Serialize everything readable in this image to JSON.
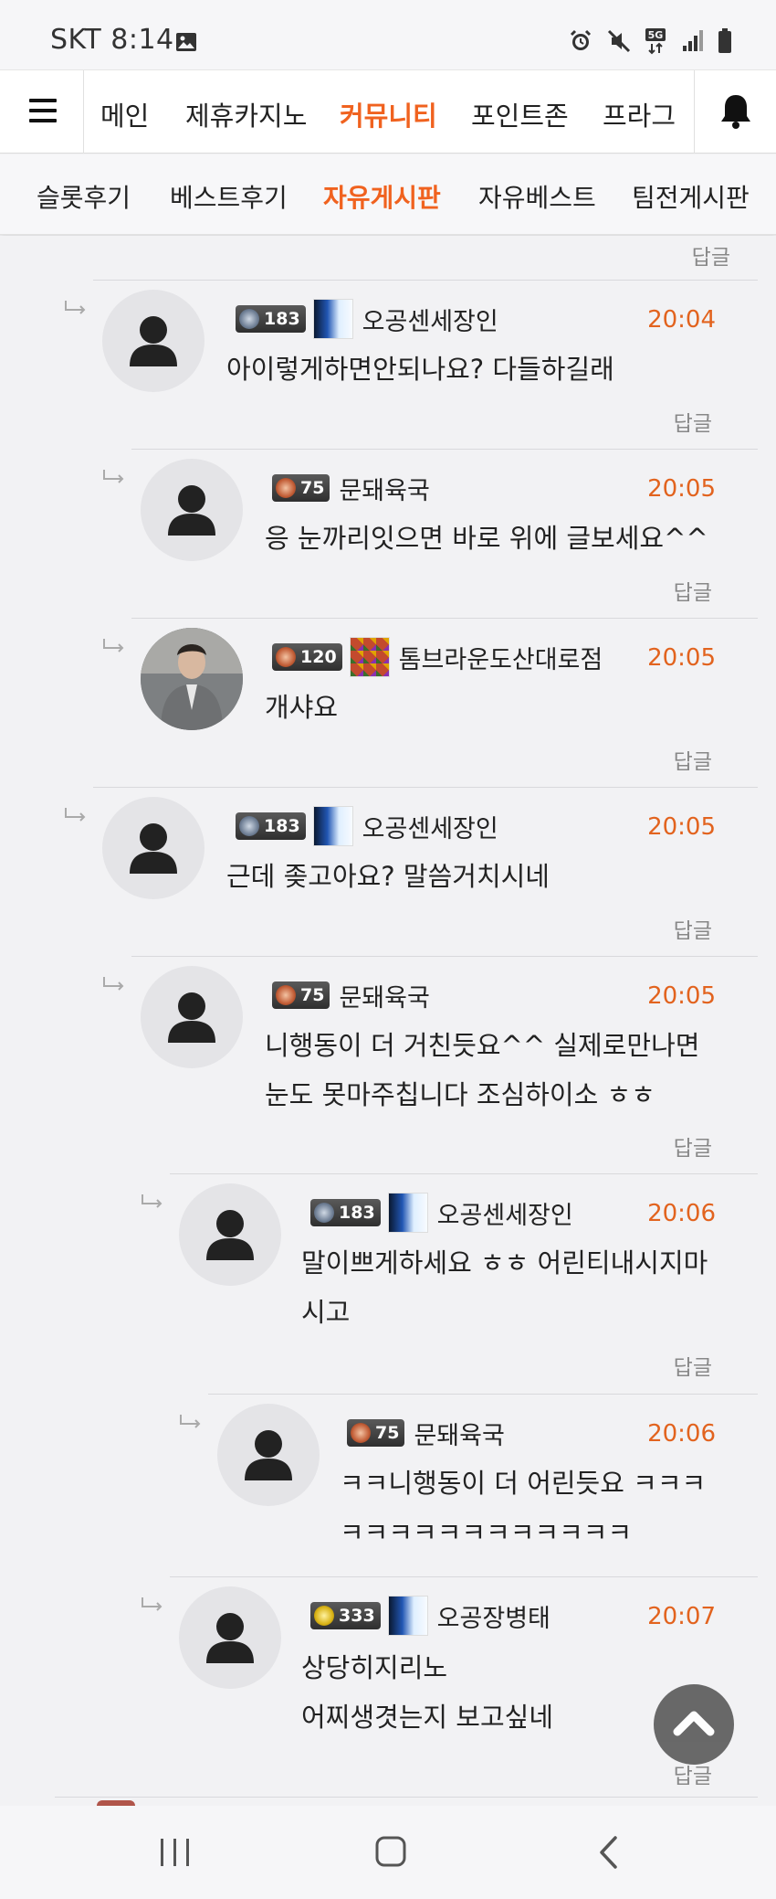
{
  "status_bar": {
    "carrier_time": "SKT 8:14",
    "icons": [
      "image-icon",
      "alarm-icon",
      "mute-icon",
      "5g-icon",
      "signal-icon",
      "battery-icon"
    ]
  },
  "main_nav": {
    "items": [
      "메인",
      "제휴카지노",
      "커뮤니티",
      "포인트존",
      "프라그"
    ],
    "active": "커뮤니티"
  },
  "sub_nav": {
    "items": [
      "슬롯후기",
      "베스트후기",
      "자유게시판",
      "자유베스트",
      "팀전게시판"
    ],
    "active": "자유게시판"
  },
  "reply_label": "답글",
  "comments": [
    {
      "level": "183",
      "nickname": "오공센세장인",
      "time": "20:04",
      "text": [
        "아이렇게하면안되나요? 다들하길래"
      ]
    },
    {
      "level": "75",
      "nickname": "문돼육국",
      "time": "20:05",
      "text": [
        "응 눈까리잇으면 바로 위에 글보세요^^"
      ]
    },
    {
      "level": "120",
      "nickname": "톰브라운도산대로점",
      "time": "20:05",
      "text": [
        "개샤요"
      ]
    },
    {
      "level": "183",
      "nickname": "오공센세장인",
      "time": "20:05",
      "text": [
        "근데 좆고아요? 말씀거치시네"
      ]
    },
    {
      "level": "75",
      "nickname": "문돼육국",
      "time": "20:05",
      "text": [
        "니행동이 더 거친듯요^^ 실제로만나면",
        "눈도 못마주칩니다 조심하이소 ㅎㅎ"
      ]
    },
    {
      "level": "183",
      "nickname": "오공센세장인",
      "time": "20:06",
      "text": [
        "말이쁘게하세요 ㅎㅎ 어린티내시지마",
        "시고"
      ]
    },
    {
      "level": "75",
      "nickname": "문돼육국",
      "time": "20:06",
      "text": [
        "ㅋㅋ니행동이 더 어린듯요 ㅋㅋㅋ",
        "ㅋㅋㅋㅋㅋㅋㅋㅋㅋㅋㅋㅋ"
      ]
    },
    {
      "level": "333",
      "nickname": "오공장병태",
      "time": "20:07",
      "text": [
        "상당히지리노",
        "어찌생겻는지 보고싶네"
      ]
    }
  ],
  "colors": {
    "accent": "#f0621f",
    "time": "#e2631e",
    "background": "#f2f2f4"
  }
}
